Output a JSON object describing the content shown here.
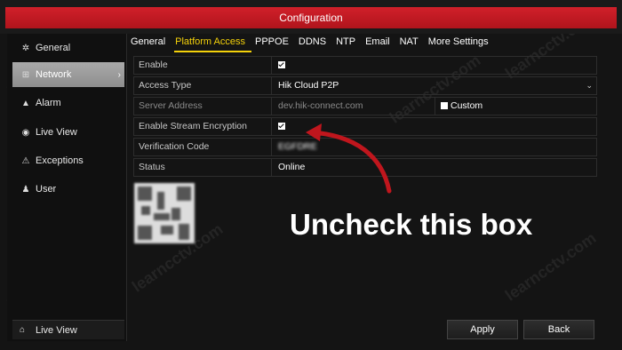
{
  "window": {
    "title": "Configuration"
  },
  "sidebar": {
    "items": [
      {
        "label": "General",
        "icon": "gear-icon"
      },
      {
        "label": "Network",
        "icon": "network-icon",
        "active": true
      },
      {
        "label": "Alarm",
        "icon": "bell-icon"
      },
      {
        "label": "Live View",
        "icon": "eye-icon"
      },
      {
        "label": "Exceptions",
        "icon": "warning-icon"
      },
      {
        "label": "User",
        "icon": "users-icon"
      }
    ],
    "bottom": {
      "label": "Live View",
      "icon": "home-icon"
    }
  },
  "tabs": [
    "General",
    "Platform Access",
    "PPPOE",
    "DDNS",
    "NTP",
    "Email",
    "NAT",
    "More Settings"
  ],
  "active_tab": "Platform Access",
  "form": {
    "enable": {
      "label": "Enable",
      "checked": true
    },
    "access_type": {
      "label": "Access Type",
      "value": "Hik Cloud P2P"
    },
    "server_address": {
      "label": "Server Address",
      "value": "dev.hik-connect.com",
      "custom_label": "Custom",
      "custom_checked": false
    },
    "stream_encryption": {
      "label": "Enable Stream Encryption",
      "checked": true
    },
    "verification_code": {
      "label": "Verification Code",
      "value": "EGFDRE"
    },
    "status": {
      "label": "Status",
      "value": "Online"
    }
  },
  "annotation": {
    "text": "Uncheck this box"
  },
  "buttons": {
    "apply": "Apply",
    "back": "Back"
  },
  "watermark": "learncctv.com",
  "colors": {
    "title_red": "#c41a22",
    "active_tab": "#f5d20a",
    "annotation_arrow": "#c0161d"
  }
}
